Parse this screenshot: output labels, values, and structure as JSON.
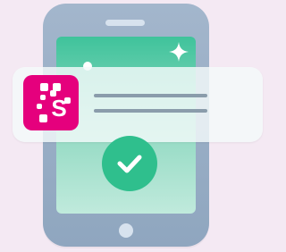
{
  "illustration": {
    "icon": "app-verified-illustration",
    "colors": {
      "background": "#f4e9f3",
      "phone": "#a3b6cc",
      "screen": "#3fc39b",
      "app_brand": "#e5007d",
      "check_badge": "#2fbf8d",
      "text_line": "#8a9cab"
    }
  },
  "notification": {
    "app_icon": "magenta-s-logo-icon",
    "app_letter": "S"
  },
  "status": {
    "icon": "check-icon"
  },
  "decorations": {
    "sparkle_icon": "sparkle-icon",
    "dot": "white-dot"
  }
}
